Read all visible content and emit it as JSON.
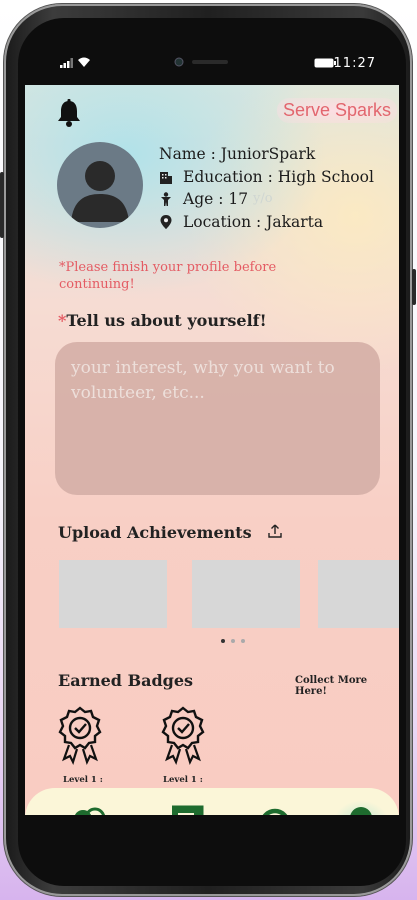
{
  "status": {
    "time": "11:27"
  },
  "app": {
    "brand": "Serve Sparks"
  },
  "profile": {
    "name_line": "Name : JuniorSpark",
    "education_line": "Education : High School",
    "age_label": "Age : 17",
    "age_unit": "y/o",
    "location_line": "Location : Jakarta"
  },
  "warning": "*Please finish your profile before continuing!",
  "about": {
    "asterisk": "*",
    "title": "Tell us about yourself!",
    "placeholder": "your interest, why you want to volunteer, etc..."
  },
  "achievements": {
    "title": "Upload Achievements"
  },
  "badges": {
    "title": "Earned Badges",
    "collect_link": "Collect More Here!",
    "items": [
      {
        "label": "Level 1 :"
      },
      {
        "label": "Level 1 :"
      }
    ]
  },
  "nav": {
    "items": [
      "community-icon",
      "book-icon",
      "search-icon",
      "profile-icon"
    ],
    "active": "profile",
    "accent": "#1e6b2e"
  }
}
